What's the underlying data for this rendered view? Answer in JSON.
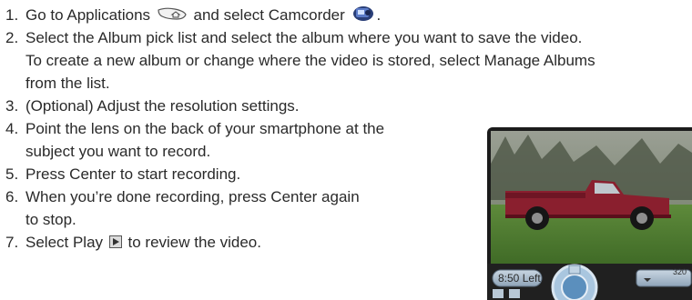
{
  "steps": [
    {
      "num": "1.",
      "before": "Go to Applications",
      "icon1": "applications-icon",
      "mid": "and select Camcorder",
      "icon2": "camcorder-icon",
      "after": "."
    },
    {
      "num": "2.",
      "line1": "Select the Album pick list and select the album where you want to save the video.",
      "line2": "To create a new album or change where the video is stored, select Manage Albums",
      "line3": "from the list."
    },
    {
      "num": "3.",
      "line1": "(Optional) Adjust the resolution settings."
    },
    {
      "num": "4.",
      "line1": "Point the lens on the back of your smartphone at the",
      "line2": "subject you want to record."
    },
    {
      "num": "5.",
      "line1": "Press Center to start recording."
    },
    {
      "num": "6.",
      "line1": "When you’re done recording, press Center again",
      "line2": "to stop."
    },
    {
      "num": "7.",
      "before": "Select Play",
      "icon1": "play-icon",
      "after": "to review the video."
    }
  ],
  "phone": {
    "time_left": "8:50 Left",
    "resolution": "320"
  }
}
